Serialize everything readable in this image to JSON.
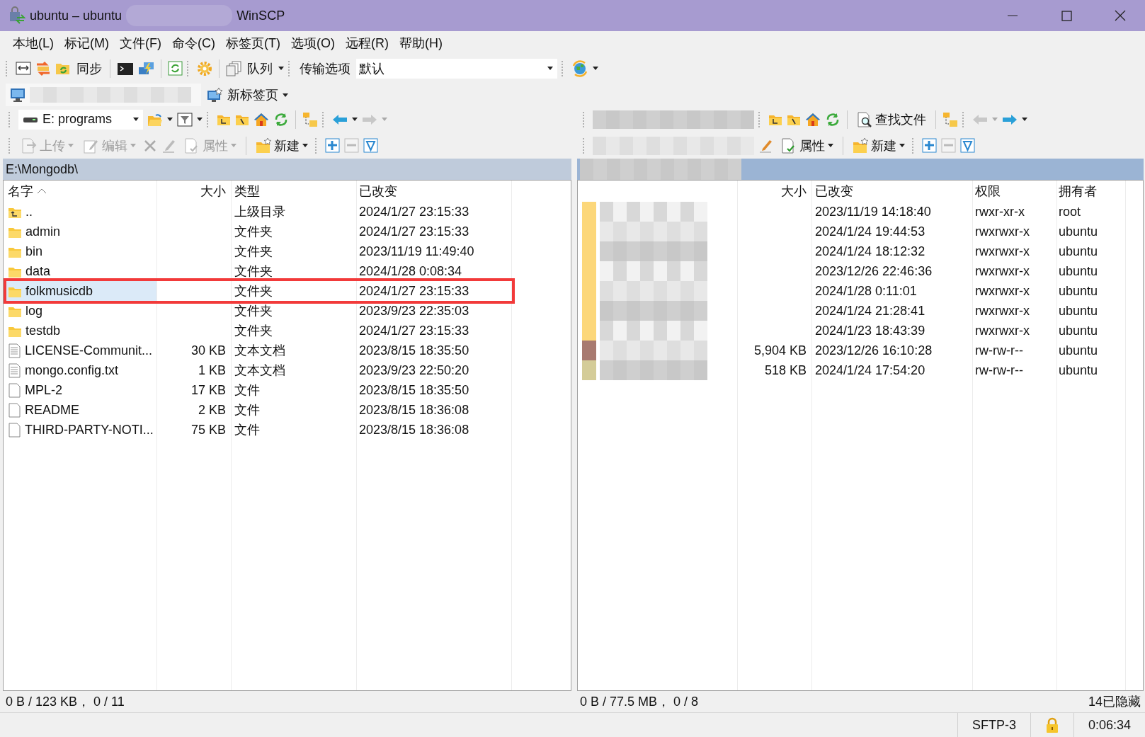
{
  "window": {
    "title_start": "ubuntu – ubuntu",
    "title_end": "WinSCP"
  },
  "menu": [
    "本地(L)",
    "标记(M)",
    "文件(F)",
    "命令(C)",
    "标签页(T)",
    "选项(O)",
    "远程(R)",
    "帮助(H)"
  ],
  "toolbar": {
    "sync_label": "同步",
    "queue_label": "队列",
    "transfer_label": "传输选项",
    "transfer_value": "默认"
  },
  "new_tab": "新标签页",
  "left_panel": {
    "drive": "E: programs",
    "actions": [
      {
        "kind": "upload",
        "label": "上传",
        "disabled": true
      },
      {
        "kind": "edit",
        "label": "编辑",
        "disabled": true
      },
      {
        "kind": "properties",
        "label": "属性",
        "disabled": true
      },
      {
        "kind": "new",
        "label": "新建",
        "disabled": false
      }
    ],
    "path": "E:\\Mongodb\\",
    "columns": [
      "名字",
      "大小",
      "类型",
      "已改变"
    ],
    "rows": [
      {
        "kind": "parent",
        "name": "..",
        "size": "",
        "type": "上级目录",
        "changed": "2024/1/27 23:15:33",
        "selected": false,
        "highlighted": false
      },
      {
        "kind": "folder",
        "name": "admin",
        "size": "",
        "type": "文件夹",
        "changed": "2024/1/27 23:15:33",
        "selected": false,
        "highlighted": false
      },
      {
        "kind": "folder",
        "name": "bin",
        "size": "",
        "type": "文件夹",
        "changed": "2023/11/19 11:49:40",
        "selected": false,
        "highlighted": false
      },
      {
        "kind": "folder",
        "name": "data",
        "size": "",
        "type": "文件夹",
        "changed": "2024/1/28 0:08:34",
        "selected": false,
        "highlighted": false
      },
      {
        "kind": "folder",
        "name": "folkmusicdb",
        "size": "",
        "type": "文件夹",
        "changed": "2024/1/27 23:15:33",
        "selected": true,
        "highlighted": true
      },
      {
        "kind": "folder",
        "name": "log",
        "size": "",
        "type": "文件夹",
        "changed": "2023/9/23 22:35:03",
        "selected": false,
        "highlighted": false
      },
      {
        "kind": "folder",
        "name": "testdb",
        "size": "",
        "type": "文件夹",
        "changed": "2024/1/27 23:15:33",
        "selected": false,
        "highlighted": false
      },
      {
        "kind": "text",
        "name": "LICENSE-Communit...",
        "size": "30 KB",
        "type": "文本文档",
        "changed": "2023/8/15 18:35:50",
        "selected": false,
        "highlighted": false
      },
      {
        "kind": "text",
        "name": "mongo.config.txt",
        "size": "1 KB",
        "type": "文本文档",
        "changed": "2023/9/23 22:50:20",
        "selected": false,
        "highlighted": false
      },
      {
        "kind": "file",
        "name": "MPL-2",
        "size": "17 KB",
        "type": "文件",
        "changed": "2023/8/15 18:35:50",
        "selected": false,
        "highlighted": false
      },
      {
        "kind": "file",
        "name": "README",
        "size": "2 KB",
        "type": "文件",
        "changed": "2023/8/15 18:36:08",
        "selected": false,
        "highlighted": false
      },
      {
        "kind": "file",
        "name": "THIRD-PARTY-NOTI...",
        "size": "75 KB",
        "type": "文件",
        "changed": "2023/8/15 18:36:08",
        "selected": false,
        "highlighted": false
      }
    ],
    "status": "0 B / 123 KB， 0 / 11"
  },
  "right_panel": {
    "find_label": "查找文件",
    "actions": [
      {
        "kind": "properties",
        "label": "属性",
        "disabled": false
      },
      {
        "kind": "new",
        "label": "新建",
        "disabled": false
      }
    ],
    "columns": [
      "大小",
      "已改变",
      "权限",
      "拥有者"
    ],
    "rows": [
      {
        "kind": "folder",
        "size": "",
        "changed": "2023/11/19 14:18:40",
        "permissions": "rwxr-xr-x",
        "owner": "root"
      },
      {
        "kind": "folder",
        "size": "",
        "changed": "2024/1/24 19:44:53",
        "permissions": "rwxrwxr-x",
        "owner": "ubuntu"
      },
      {
        "kind": "folder",
        "size": "",
        "changed": "2024/1/24 18:12:32",
        "permissions": "rwxrwxr-x",
        "owner": "ubuntu"
      },
      {
        "kind": "folder",
        "size": "",
        "changed": "2023/12/26 22:46:36",
        "permissions": "rwxrwxr-x",
        "owner": "ubuntu"
      },
      {
        "kind": "folder",
        "size": "",
        "changed": "2024/1/28 0:11:01",
        "permissions": "rwxrwxr-x",
        "owner": "ubuntu"
      },
      {
        "kind": "folder",
        "size": "",
        "changed": "2024/1/24 21:28:41",
        "permissions": "rwxrwxr-x",
        "owner": "ubuntu"
      },
      {
        "kind": "folder",
        "size": "",
        "changed": "2024/1/23 18:43:39",
        "permissions": "rwxrwxr-x",
        "owner": "ubuntu"
      },
      {
        "kind": "archive",
        "size": "5,904 KB",
        "changed": "2023/12/26 16:10:28",
        "permissions": "rw-rw-r--",
        "owner": "ubuntu"
      },
      {
        "kind": "package",
        "size": "518 KB",
        "changed": "2024/1/24 17:54:20",
        "permissions": "rw-rw-r--",
        "owner": "ubuntu"
      }
    ],
    "status": "0 B / 77.5 MB， 0 / 8",
    "hidden": "14已隐藏"
  },
  "status_bar": {
    "protocol": "SFTP-3",
    "time": "0:06:34"
  }
}
